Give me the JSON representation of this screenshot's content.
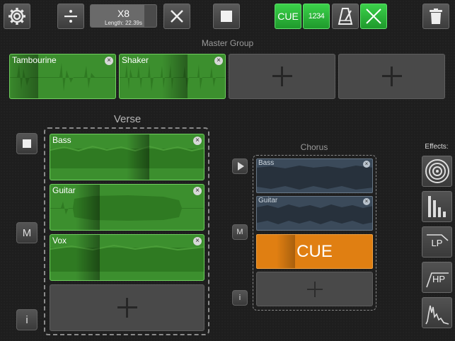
{
  "toolbar": {
    "loop_count": "X8",
    "length_text": "Length: 22.39s",
    "cue_label": "CUE",
    "count_in_label": "1234"
  },
  "master_group": {
    "title": "Master Group",
    "clips": [
      {
        "name": "Tambourine"
      },
      {
        "name": "Shaker"
      }
    ]
  },
  "verse": {
    "title": "Verse",
    "clips": [
      {
        "name": "Bass"
      },
      {
        "name": "Guitar"
      },
      {
        "name": "Vox"
      }
    ],
    "mute_label": "M",
    "info_label": "i"
  },
  "chorus": {
    "title": "Chorus",
    "clips": [
      {
        "name": "Bass"
      },
      {
        "name": "Guitar"
      }
    ],
    "cue_label": "CUE",
    "mute_label": "M",
    "info_label": "i"
  },
  "effects": {
    "title": "Effects:",
    "lp_label": "LP",
    "hp_label": "HP"
  },
  "colors": {
    "clip_green": "#3c8f2e",
    "accent_green": "#2fbf3c",
    "cue_orange": "#e07f12",
    "chorus_clip": "#3b4a5a"
  }
}
